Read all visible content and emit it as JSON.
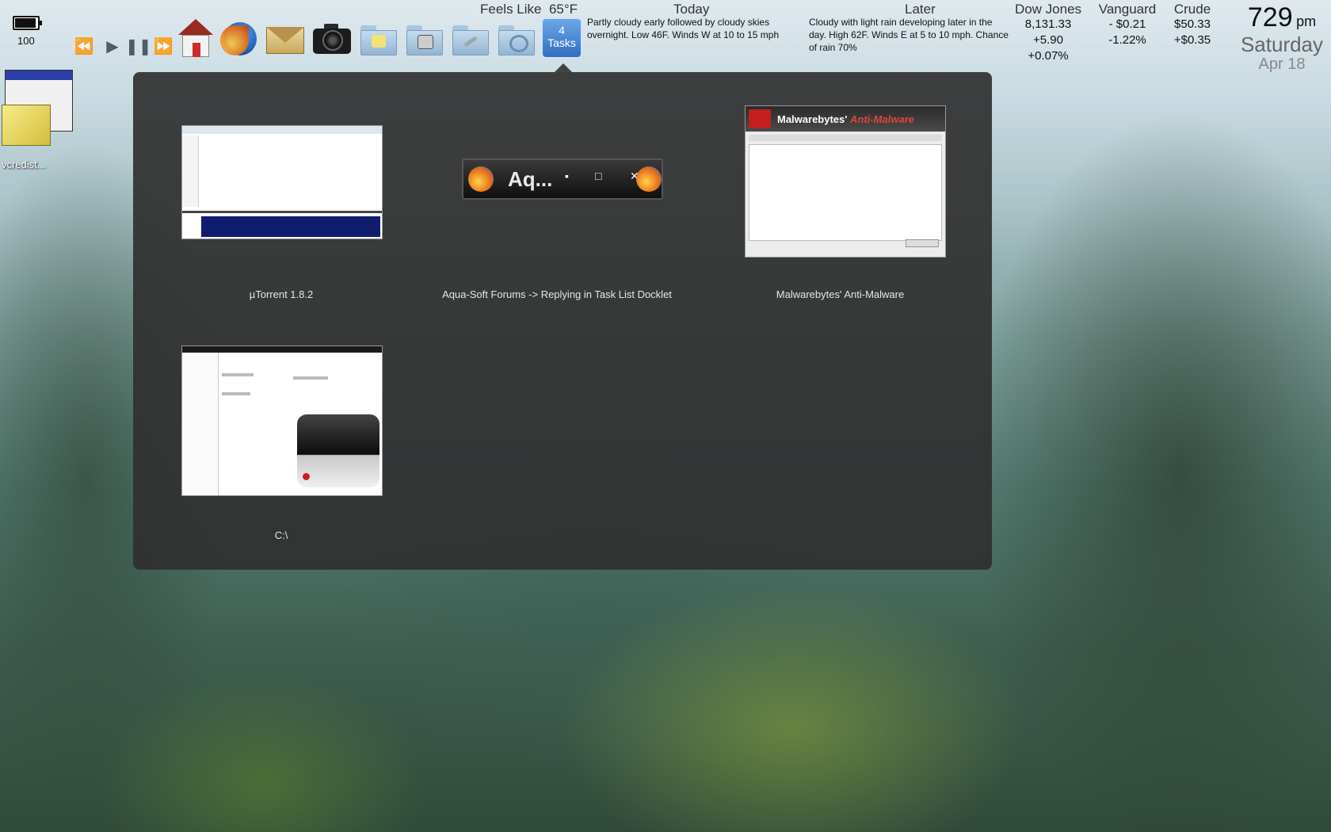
{
  "battery": {
    "level": 100,
    "label": "100"
  },
  "media": {
    "rewind_icon": "rewind-icon",
    "play_icon": "play-icon",
    "pause_icon": "pause-icon",
    "forward_icon": "fast-forward-icon"
  },
  "dock": {
    "icons": [
      "home-icon",
      "firefox-icon",
      "mail-icon",
      "camera-icon",
      "documents-folder-icon",
      "games-folder-icon",
      "tools-folder-icon",
      "settings-folder-icon"
    ],
    "tasks_count": "4",
    "tasks_label": "Tasks"
  },
  "weather": {
    "feels_like_label": "Feels Like",
    "feels_like_value": "65°F",
    "today_label": "Today",
    "today_text": "Partly cloudy early followed by cloudy skies overnight. Low 46F. Winds W at 10 to 15 mph",
    "later_label": "Later",
    "later_text": "Cloudy with light rain developing later in the day. High 62F. Winds E at 5 to 10 mph. Chance of rain 70%"
  },
  "stocks": {
    "dow": {
      "name": "Dow Jones",
      "value": "8,131.33",
      "change": "+5.90",
      "percent": "+0.07%"
    },
    "vanguard": {
      "name": "Vanguard",
      "change": "- $0.21",
      "percent": "-1.22%"
    },
    "crude": {
      "name": "Crude",
      "value": "$50.33",
      "change": "+$0.35"
    }
  },
  "clock": {
    "time": "729",
    "ampm": "pm",
    "day": "Saturday",
    "date": "Apr 18"
  },
  "desktop": {
    "icon_label": "vcredist..."
  },
  "tasks": [
    {
      "title": "µTorrent 1.8.2"
    },
    {
      "title": "Aqua-Soft Forums -> Replying in Task List Docklet",
      "thumb_text": "Aq..."
    },
    {
      "title": "Malwarebytes' Anti-Malware",
      "thumb_brand": "Malwarebytes'",
      "thumb_brand2": "Anti-Malware"
    },
    {
      "title": "C:\\"
    }
  ]
}
